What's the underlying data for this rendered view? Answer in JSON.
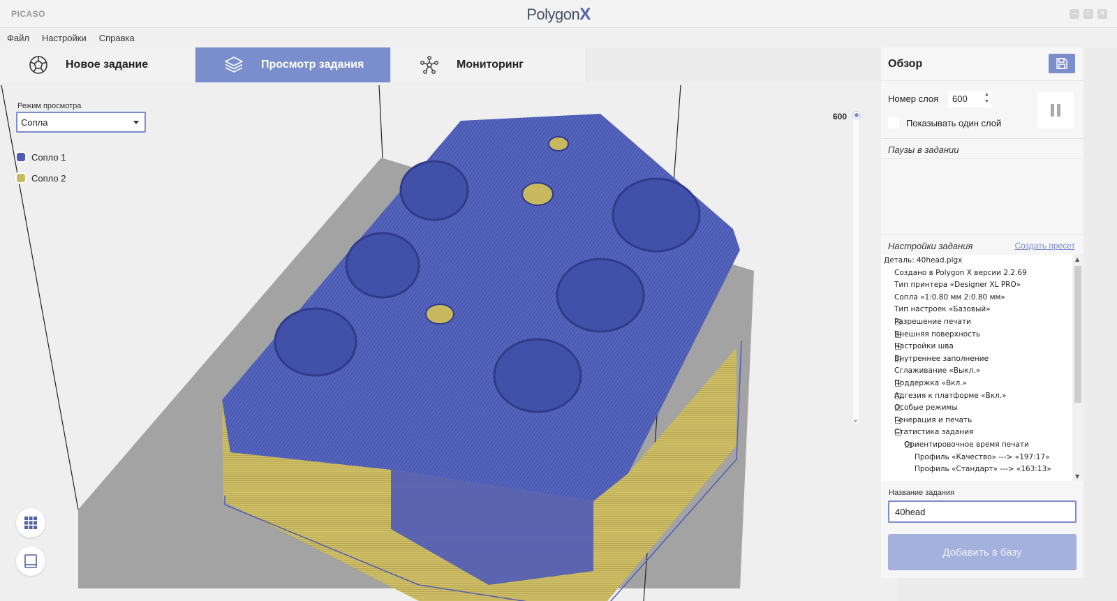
{
  "titlebar": {
    "brand_left": "PICASO",
    "brand_main": "Polygon",
    "brand_x": "X",
    "controls": [
      "‒",
      "□",
      "✕"
    ]
  },
  "menu": {
    "items": [
      "Файл",
      "Настройки",
      "Справка"
    ]
  },
  "tabs": [
    {
      "label": "Новое задание",
      "icon": "dodecahedron-icon",
      "active": false
    },
    {
      "label": "Просмотр задания",
      "icon": "layers-icon",
      "active": true
    },
    {
      "label": "Мониторинг",
      "icon": "network-icon",
      "active": false
    }
  ],
  "viewport": {
    "mode_label": "Режим просмотра",
    "mode_value": "Сопла",
    "legend": [
      {
        "label": "Сопло 1",
        "color": "#4e5bb8"
      },
      {
        "label": "Сопло 2",
        "color": "#c9b95e"
      }
    ],
    "layer_slider_value": "600",
    "buttons": [
      "grid-view-icon",
      "tablet-view-icon"
    ]
  },
  "panel": {
    "title": "Обзор",
    "layer_label": "Номер слоя",
    "layer_value": "600",
    "show_one_layer": "Показывать один слой",
    "pauses_title": "Паузы в задании",
    "settings_title": "Настройки задания",
    "create_preset": "Создать пресет",
    "tree": [
      {
        "text": "Деталь: 40head.plgx",
        "level": 0,
        "exp": ""
      },
      {
        "text": "Создано в Polygon X версии  2.2.69",
        "level": 1,
        "exp": ""
      },
      {
        "text": "Тип принтера «Designer XL PRO»",
        "level": 1,
        "exp": ""
      },
      {
        "text": "Сопла «1:0.80 мм 2:0.80 мм»",
        "level": 1,
        "exp": ""
      },
      {
        "text": "Тип настроек «Базовый»",
        "level": 1,
        "exp": ""
      },
      {
        "text": "Разрешение печати",
        "level": 1,
        "exp": "+"
      },
      {
        "text": "Внешняя поверхность",
        "level": 1,
        "exp": "+"
      },
      {
        "text": "Настройки шва",
        "level": 1,
        "exp": "+"
      },
      {
        "text": "Внутреннее заполнение",
        "level": 1,
        "exp": "+"
      },
      {
        "text": "Сглаживание «Выкл.»",
        "level": 1,
        "exp": ""
      },
      {
        "text": "Поддержка «Вкл.»",
        "level": 1,
        "exp": "+"
      },
      {
        "text": "Адгезия к платформе «Вкл.»",
        "level": 1,
        "exp": "+"
      },
      {
        "text": "Особые режимы",
        "level": 1,
        "exp": "+"
      },
      {
        "text": "Генерация и печать",
        "level": 1,
        "exp": "+"
      },
      {
        "text": "Статистика задания",
        "level": 1,
        "exp": "−"
      },
      {
        "text": "Ориентировочное время печати",
        "level": 2,
        "exp": "−"
      },
      {
        "text": "Профиль «Качество» ---> «197:17»",
        "level": 3,
        "exp": ""
      },
      {
        "text": "Профиль «Стандарт» ---> «163:13»",
        "level": 3,
        "exp": ""
      }
    ],
    "job_name_label": "Название задания",
    "job_name_value": "40head",
    "add_button": "Добавить в базу"
  }
}
